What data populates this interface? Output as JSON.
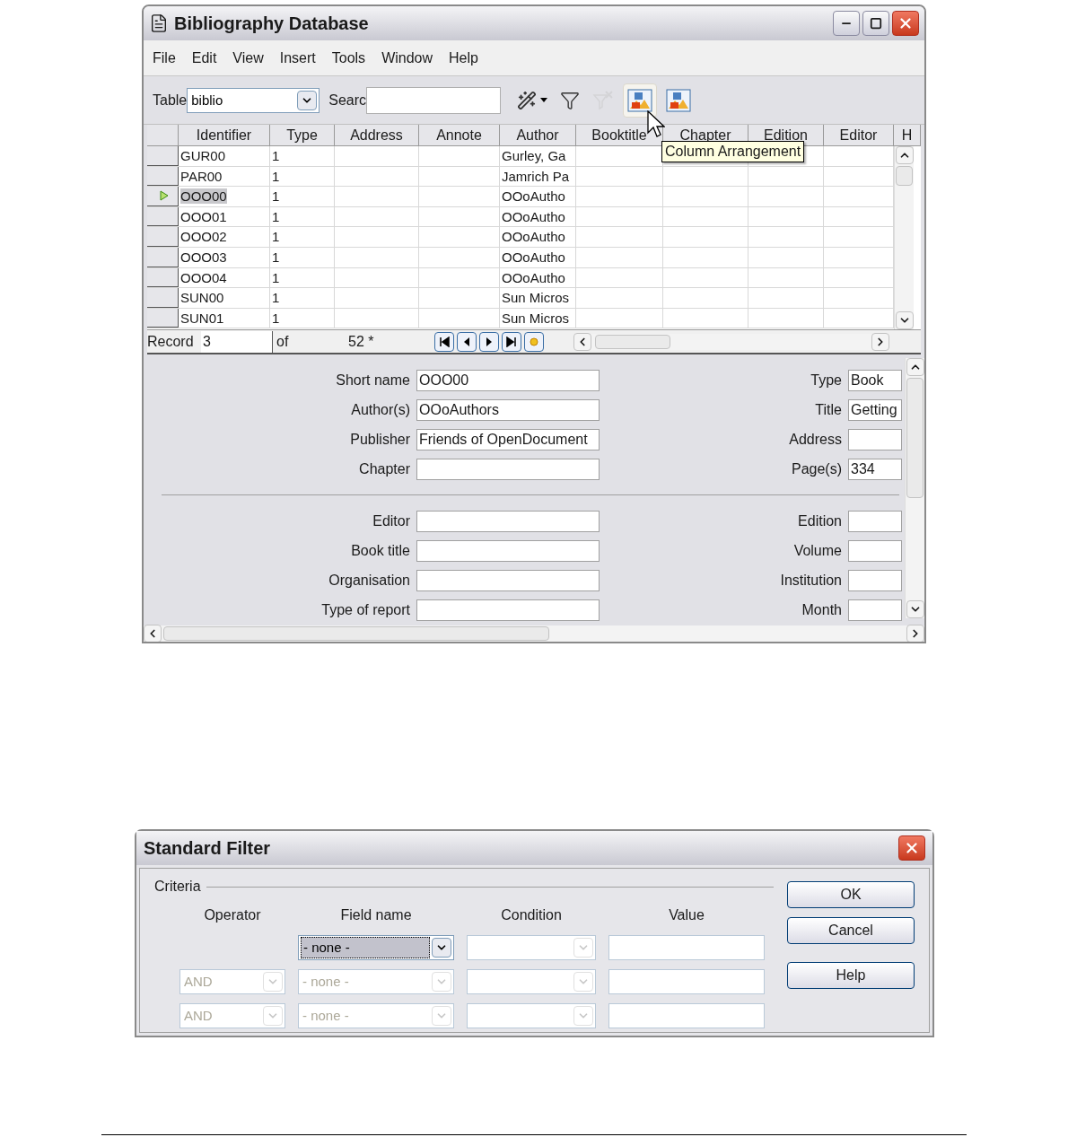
{
  "main_window": {
    "title": "Bibliography Database",
    "menu": [
      "File",
      "Edit",
      "View",
      "Insert",
      "Tools",
      "Window",
      "Help"
    ],
    "toolbar": {
      "table_label": "Table",
      "table_value": "biblio",
      "search_label": "Searc",
      "tools": [
        {
          "kind": "autofilter",
          "disabled": false,
          "hovered": false
        },
        {
          "kind": "filter",
          "disabled": false,
          "hovered": false
        },
        {
          "kind": "remove-filter",
          "disabled": true,
          "hovered": false
        },
        {
          "kind": "columns",
          "disabled": false,
          "hovered": true
        },
        {
          "kind": "source",
          "disabled": false,
          "hovered": false
        }
      ]
    },
    "tooltip": "Column Arrangement",
    "grid": {
      "columns": [
        "Identifier",
        "Type",
        "Address",
        "Annote",
        "Author",
        "Booktitle",
        "Chapter",
        "Edition",
        "Editor",
        "H"
      ],
      "rows": [
        {
          "identifier": "GUR00",
          "type": "1",
          "author": "Gurley, Ga",
          "selected": false
        },
        {
          "identifier": "PAR00",
          "type": "1",
          "author": "Jamrich Pa",
          "selected": false
        },
        {
          "identifier": "OOO00",
          "type": "1",
          "author": "OOoAutho",
          "selected": true
        },
        {
          "identifier": "OOO01",
          "type": "1",
          "author": "OOoAutho",
          "selected": false
        },
        {
          "identifier": "OOO02",
          "type": "1",
          "author": "OOoAutho",
          "selected": false
        },
        {
          "identifier": "OOO03",
          "type": "1",
          "author": "OOoAutho",
          "selected": false
        },
        {
          "identifier": "OOO04",
          "type": "1",
          "author": "OOoAutho",
          "selected": false
        },
        {
          "identifier": "SUN00",
          "type": "1",
          "author": "Sun Micros",
          "selected": false
        },
        {
          "identifier": "SUN01",
          "type": "1",
          "author": "Sun Micros",
          "selected": false
        }
      ]
    },
    "record_bar": {
      "label": "Record",
      "value": "3",
      "of": "of",
      "total": "52 *"
    },
    "form": {
      "left": [
        {
          "label": "Short name",
          "value": "OOO00"
        },
        {
          "label": "Author(s)",
          "value": "OOoAuthors"
        },
        {
          "label": "Publisher",
          "value": "Friends of OpenDocument"
        },
        {
          "label": "Chapter"
        },
        {
          "label": "Editor"
        },
        {
          "label": "Book title"
        },
        {
          "label": "Organisation"
        },
        {
          "label": "Type of report"
        }
      ],
      "right": [
        {
          "label": "Type",
          "value": "Book"
        },
        {
          "label": "Title",
          "value": "Getting"
        },
        {
          "label": "Address"
        },
        {
          "label": "Page(s)",
          "value": "334"
        },
        {
          "label": "Edition"
        },
        {
          "label": "Volume"
        },
        {
          "label": "Institution"
        },
        {
          "label": "Month"
        }
      ]
    }
  },
  "filter_dialog": {
    "title": "Standard Filter",
    "group": "Criteria",
    "headers": [
      "Operator",
      "Field name",
      "Condition",
      "Value"
    ],
    "rows": [
      {
        "field": "- none -",
        "field_disabled": false,
        "focused": true
      },
      {
        "operator": "AND",
        "field": "- none -",
        "field_disabled": true,
        "focused": false
      },
      {
        "operator": "AND",
        "field": "- none -",
        "field_disabled": true,
        "focused": false
      }
    ],
    "buttons": [
      "OK",
      "Cancel",
      "Help"
    ]
  }
}
